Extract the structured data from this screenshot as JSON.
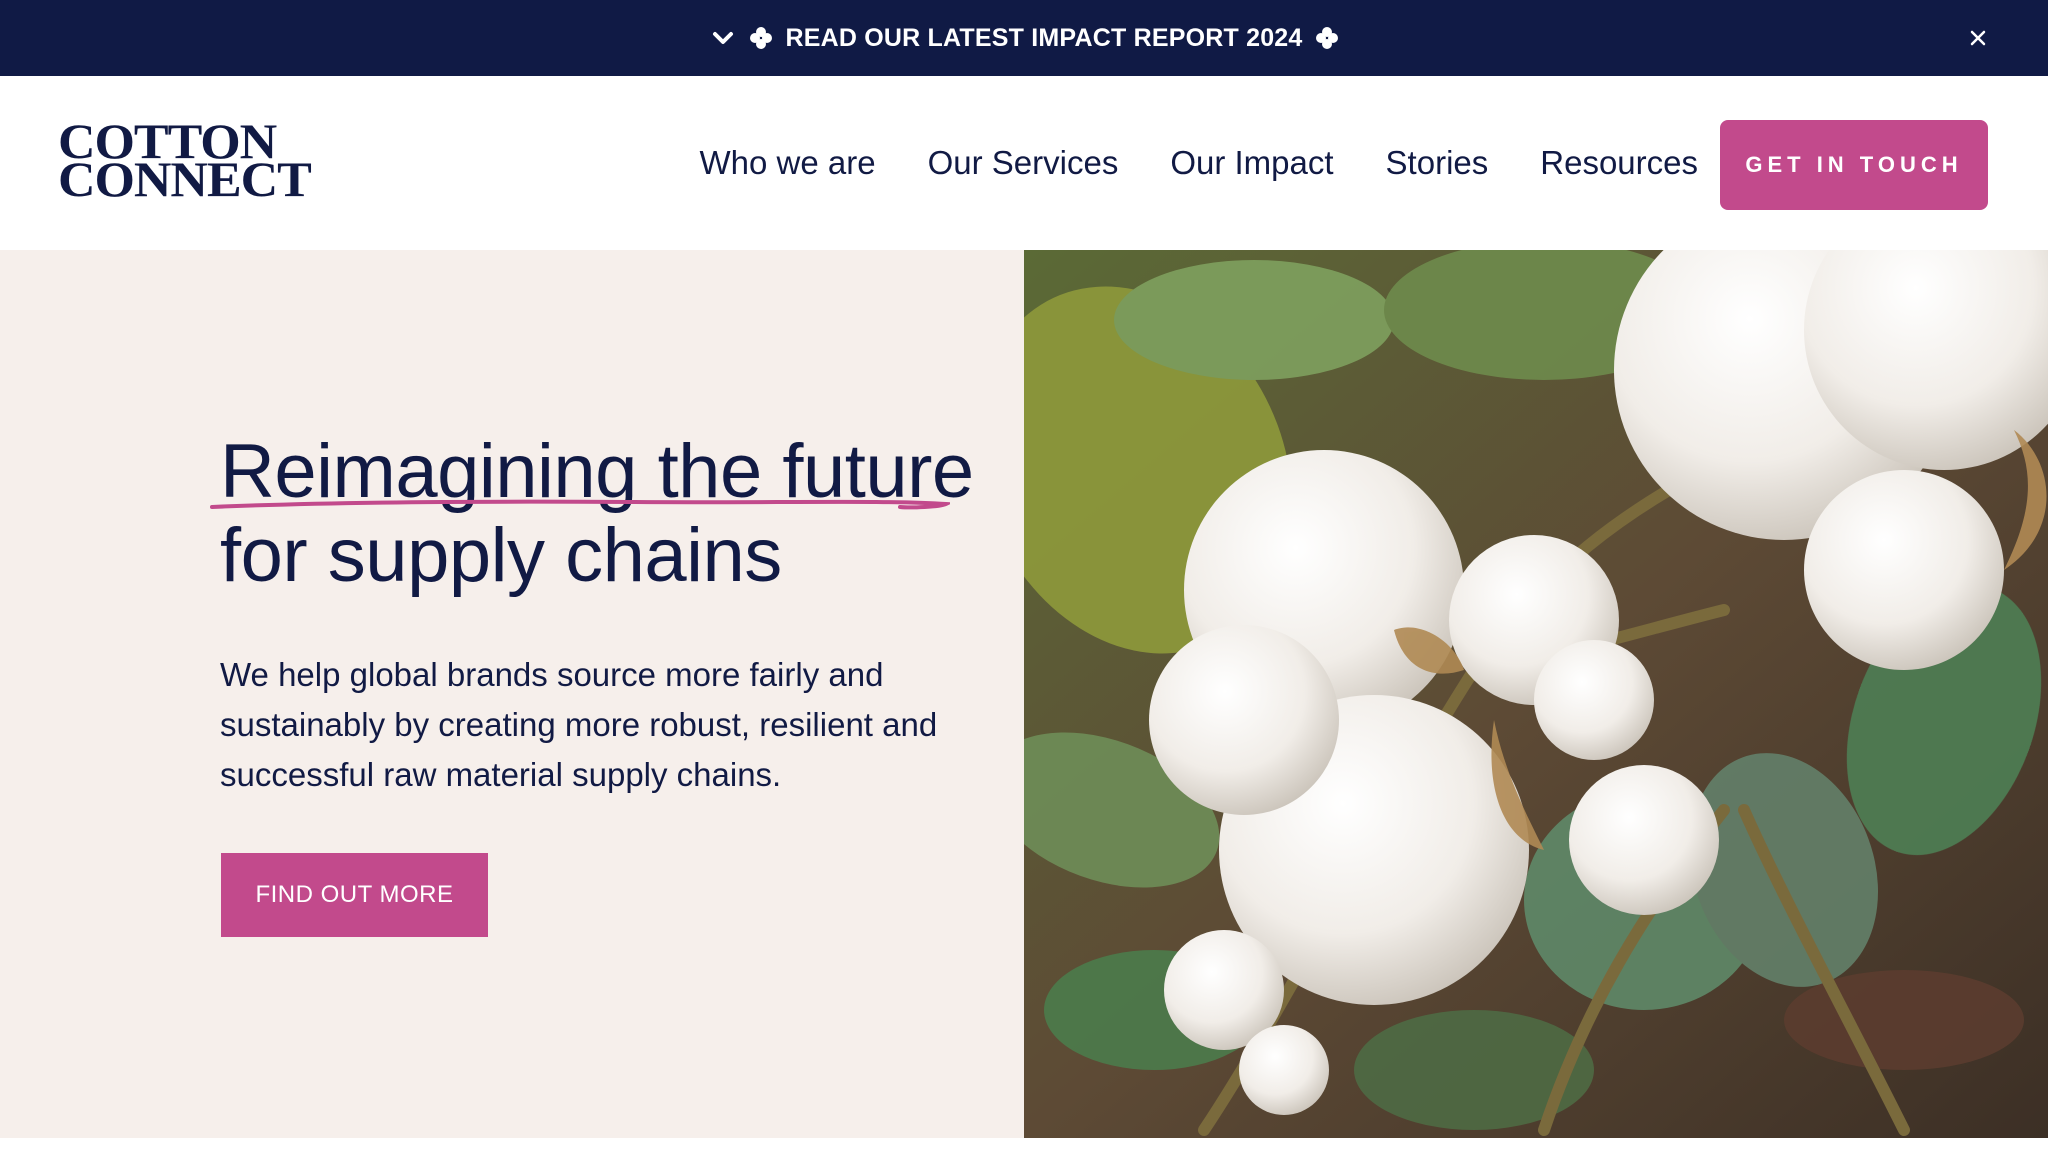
{
  "announcement": {
    "text": "READ OUR LATEST IMPACT REPORT 2024",
    "left_icon": "chevron-down-icon",
    "decor_icon": "clover-icon",
    "close_icon": "close-icon"
  },
  "header": {
    "logo_line1": "COTTON",
    "logo_line2": "CONNECT",
    "nav": [
      "Who we are",
      "Our Services",
      "Our Impact",
      "Stories",
      "Resources"
    ],
    "cta": "GET IN TOUCH"
  },
  "hero": {
    "headline_line1": "Reimagining the future",
    "headline_line2": "for supply chains",
    "subcopy": "We help global brands source more fairly and sustainably by creating more robust, resilient and successful raw material supply chains.",
    "cta": "FIND OUT MORE",
    "image_icon": "cotton-plant-photo"
  },
  "colors": {
    "navy": "#101a45",
    "pink": "#c24a8c",
    "hero_bg": "#f6efeb",
    "white": "#ffffff"
  }
}
